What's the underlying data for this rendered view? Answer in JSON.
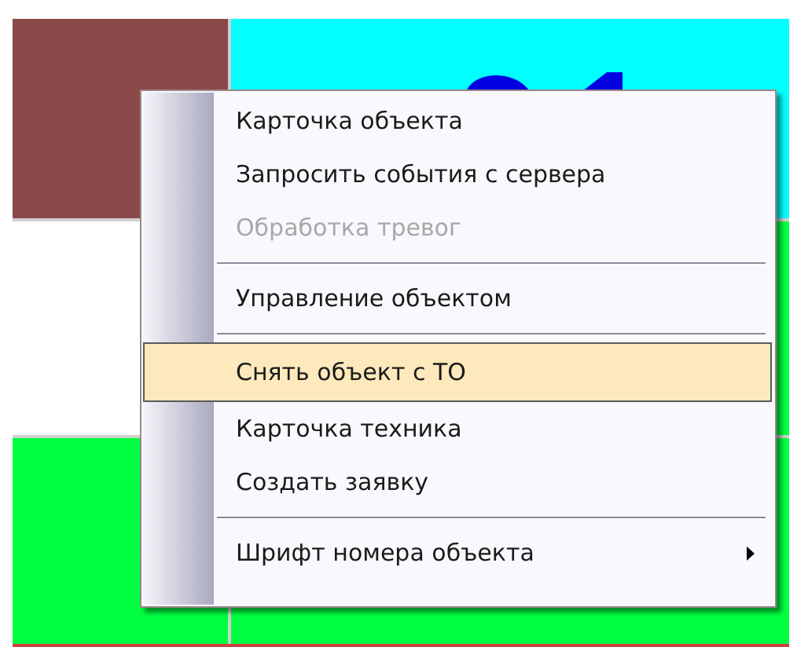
{
  "tiles": [
    {
      "color": "#8b4a4a"
    },
    {
      "color": "#00ffff",
      "number": true
    },
    {
      "color": "#ffffff"
    },
    {
      "color": "#00ff40"
    },
    {
      "color": "#00ff40"
    },
    {
      "color": "#00ff40"
    }
  ],
  "context_menu": {
    "items": [
      {
        "kind": "item",
        "label": "Карточка объекта",
        "disabled": false,
        "selected": false,
        "submenu": false
      },
      {
        "kind": "item",
        "label": "Запросить события с сервера",
        "disabled": false,
        "selected": false,
        "submenu": false
      },
      {
        "kind": "item",
        "label": "Обработка тревог",
        "disabled": true,
        "selected": false,
        "submenu": false
      },
      {
        "kind": "separator"
      },
      {
        "kind": "item",
        "label": "Управление объектом",
        "disabled": false,
        "selected": false,
        "submenu": false
      },
      {
        "kind": "separator"
      },
      {
        "kind": "item",
        "label": "Снять объект с ТО",
        "disabled": false,
        "selected": true,
        "submenu": false
      },
      {
        "kind": "item",
        "label": "Карточка техника",
        "disabled": false,
        "selected": false,
        "submenu": false
      },
      {
        "kind": "item",
        "label": "Создать заявку",
        "disabled": false,
        "selected": false,
        "submenu": false
      },
      {
        "kind": "separator"
      },
      {
        "kind": "item",
        "label": "Шрифт номера объекта",
        "disabled": false,
        "selected": false,
        "submenu": true
      }
    ]
  }
}
